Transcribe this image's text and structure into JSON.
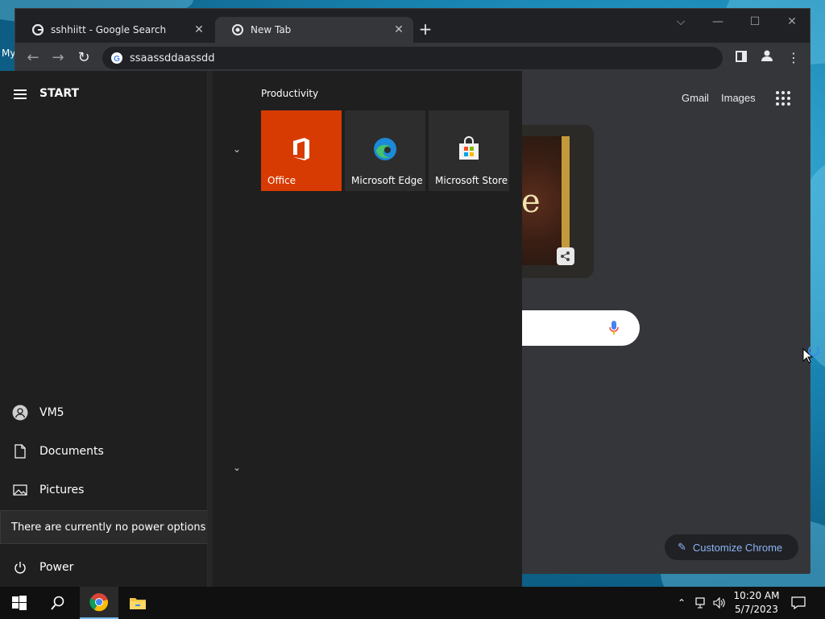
{
  "desktop": {
    "label": "My"
  },
  "chrome": {
    "tabs": [
      {
        "title": "sshhiitt - Google Search",
        "active": false
      },
      {
        "title": "New Tab",
        "active": true
      }
    ],
    "new_tab_label": "+",
    "window_controls": {
      "dropdown": "⌵",
      "minimize": "—",
      "maximize": "☐",
      "close": "✕"
    },
    "address": "ssaassddaassdd",
    "page": {
      "gmail": "Gmail",
      "images": "Images",
      "doodle_letter": "e",
      "customize": "Customize Chrome"
    }
  },
  "start_menu": {
    "title": "START",
    "user": "VM5",
    "items": {
      "documents": "Documents",
      "pictures": "Pictures",
      "power": "Power"
    },
    "tooltip": "There are currently no power options available.",
    "group_title": "Productivity",
    "tiles": [
      {
        "label": "Office",
        "color": "#d83b01"
      },
      {
        "label": "Microsoft Edge",
        "color": "#2d2d2d"
      },
      {
        "label": "Microsoft Store",
        "color": "#2d2d2d"
      }
    ]
  },
  "taskbar": {
    "apps": [
      "windows-start-icon",
      "search-icon",
      "chrome-icon",
      "file-explorer-icon"
    ],
    "time": "10:20 AM",
    "date": "5/7/2023"
  },
  "colors": {
    "accent": "#8ab4f8",
    "office": "#d83b01"
  }
}
